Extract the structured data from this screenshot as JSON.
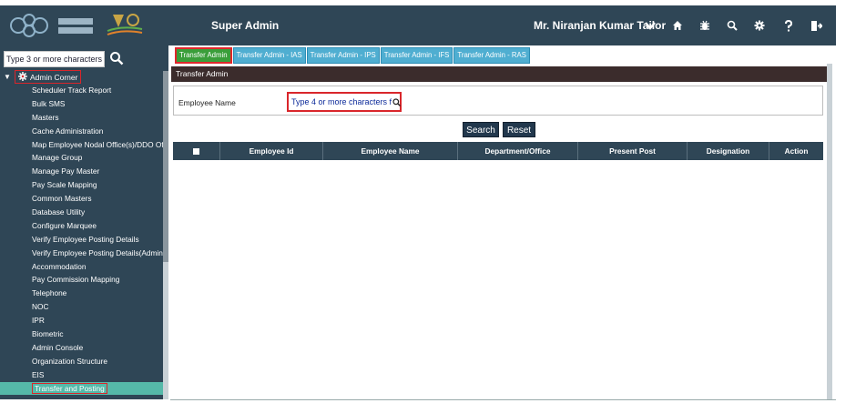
{
  "header": {
    "app_title": "Super Admin",
    "user_name": "Mr. Niranjan Kumar Tailor",
    "icons": [
      "chevron-down-icon",
      "home-icon",
      "bug-icon",
      "search-icon",
      "gear-icon",
      "help-icon",
      "logout-icon"
    ]
  },
  "sidebar": {
    "search_placeholder": "Type 3 or more characters",
    "corner_label": "Admin Corner",
    "items": [
      {
        "label": "Scheduler Track Report"
      },
      {
        "label": "Bulk SMS"
      },
      {
        "label": "Masters"
      },
      {
        "label": "Cache Administration"
      },
      {
        "label": "Map Employee Nodal Office(s)/DDO Offi"
      },
      {
        "label": "Manage Group"
      },
      {
        "label": "Manage Pay Master"
      },
      {
        "label": "Pay Scale Mapping"
      },
      {
        "label": "Common Masters"
      },
      {
        "label": "Database Utility"
      },
      {
        "label": "Configure Marquee"
      },
      {
        "label": "Verify Employee Posting Details"
      },
      {
        "label": "Verify Employee Posting Details(Admin)"
      },
      {
        "label": "Accommodation"
      },
      {
        "label": "Pay Commission Mapping"
      },
      {
        "label": "Telephone"
      },
      {
        "label": "NOC"
      },
      {
        "label": "IPR"
      },
      {
        "label": "Biometric"
      },
      {
        "label": "Admin Console"
      },
      {
        "label": "Organization Structure"
      },
      {
        "label": "EIS"
      },
      {
        "label": "Transfer and Posting"
      }
    ]
  },
  "tabs": [
    {
      "label": "Transfer Admin"
    },
    {
      "label": "Transfer Admin - IAS"
    },
    {
      "label": "Transfer Admin - IPS"
    },
    {
      "label": "Transfer Admin - IFS"
    },
    {
      "label": "Transfer Admin - RAS"
    }
  ],
  "panel": {
    "title": "Transfer Admin",
    "employee_label": "Employee Name",
    "employee_placeholder": "Type 4 or more characters f",
    "search_button": "Search",
    "reset_button": "Reset"
  },
  "grid": {
    "columns": [
      "Employee Id",
      "Employee Name",
      "Department/Office",
      "Present Post",
      "Designation",
      "Action"
    ]
  },
  "colors": {
    "header_bg": "#2f4656",
    "active_tab": "#3a9e3a",
    "tab": "#4faed1",
    "highlight_border": "#d9262b",
    "active_menu": "#55b9a9"
  }
}
